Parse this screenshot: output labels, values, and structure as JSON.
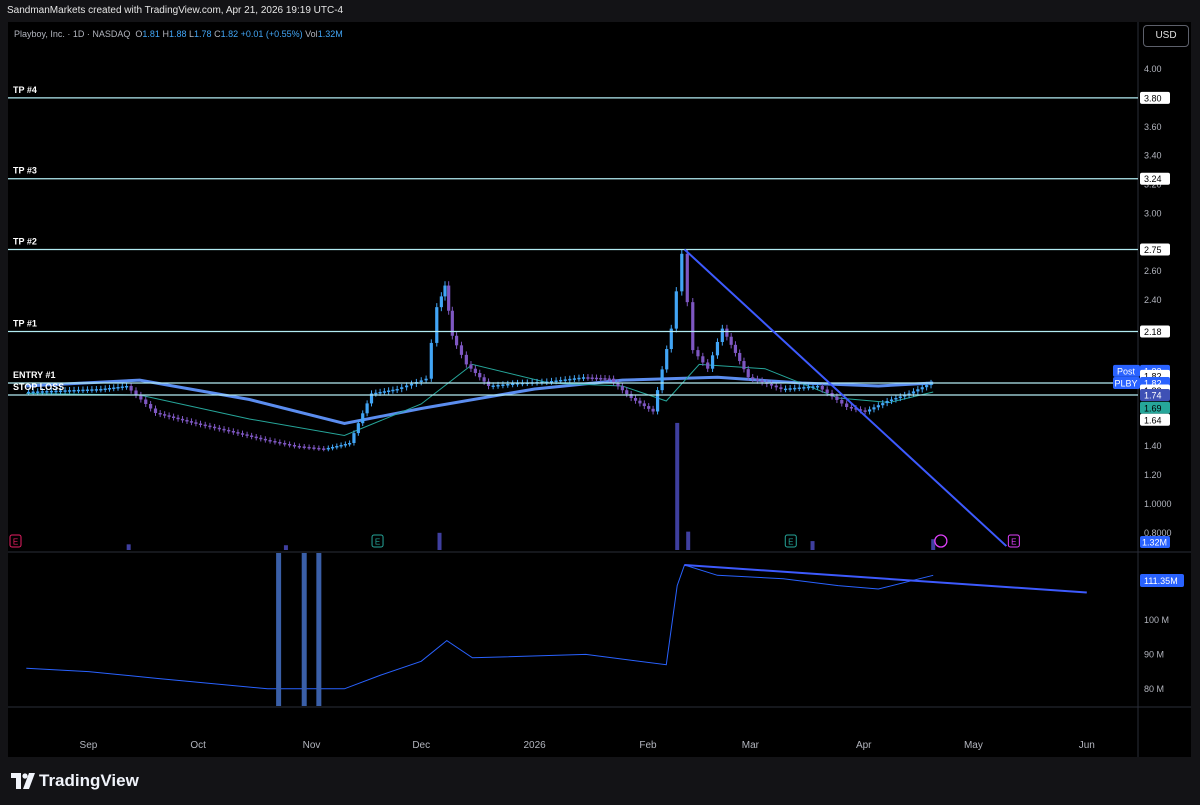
{
  "header": {
    "attribution": "SandmanMarkets created with TradingView.com, Apr 21, 2026 19:19 UTC-4"
  },
  "legend": {
    "symbol": "Playboy, Inc. · 1D · NASDAQ",
    "open_label": "O",
    "open": "1.81",
    "high_label": "H",
    "high": "1.88",
    "low_label": "L",
    "low": "1.78",
    "close_label": "C",
    "close": "1.82",
    "change": "+0.01 (+0.55%)",
    "volume_label": "Vol",
    "volume": "1.32M"
  },
  "currency_button": "USD",
  "brand": {
    "name": "TradingView"
  },
  "colors": {
    "up": "#42a5f5",
    "down": "#7e57c2",
    "ma_slow": "#5b8def",
    "ma_fast": "#2196f3",
    "ma_teal": "#26a69a",
    "level": "#b2ebf2",
    "trendline": "#3d5afe",
    "volume": "#3f3f9f"
  },
  "chart_data": {
    "type": "candlestick",
    "title": "Playboy, Inc. · 1D · NASDAQ",
    "y_ticks": [
      "4.00",
      "3.60",
      "3.40",
      "3.20",
      "3.00",
      "2.60",
      "2.40",
      "1.40",
      "1.20",
      "1.0000",
      "0.8000"
    ],
    "x_ticks": [
      {
        "label": "Sep",
        "date": "2025-09-01"
      },
      {
        "label": "Oct",
        "date": "2025-10-01"
      },
      {
        "label": "Nov",
        "date": "2025-11-01"
      },
      {
        "label": "Dec",
        "date": "2025-12-01"
      },
      {
        "label": "2026",
        "date": "2026-01-01"
      },
      {
        "label": "Feb",
        "date": "2026-02-01"
      },
      {
        "label": "Mar",
        "date": "2026-03-01"
      },
      {
        "label": "Apr",
        "date": "2026-04-01"
      },
      {
        "label": "May",
        "date": "2026-05-01"
      },
      {
        "label": "Jun",
        "date": "2026-06-01"
      }
    ],
    "levels": [
      {
        "name": "TP #4",
        "value": 3.8
      },
      {
        "name": "TP #3",
        "value": 3.24
      },
      {
        "name": "TP #2",
        "value": 2.75
      },
      {
        "name": "TP #1",
        "value": 2.18
      },
      {
        "name": "ENTRY #1",
        "value": 1.82
      },
      {
        "name": "STOP LOSS",
        "value": 1.74
      }
    ],
    "price_tags": [
      {
        "label": "",
        "value": "3.80",
        "price": 3.8,
        "bg": "#ffffff",
        "fg": "#000000"
      },
      {
        "label": "",
        "value": "3.24",
        "price": 3.24,
        "bg": "#ffffff",
        "fg": "#000000"
      },
      {
        "label": "",
        "value": "2.75",
        "price": 2.75,
        "bg": "#ffffff",
        "fg": "#000000"
      },
      {
        "label": "",
        "value": "2.18",
        "price": 2.18,
        "bg": "#ffffff",
        "fg": "#000000"
      },
      {
        "label": "Post",
        "value": "1.82",
        "price": 1.905,
        "bg": "#2962ff",
        "fg": "#ffffff"
      },
      {
        "label": "",
        "value": "1.82",
        "price": 1.87,
        "bg": "#ffffff",
        "fg": "#000000"
      },
      {
        "label": "PLBY",
        "value": "1.82",
        "price": 1.82,
        "bg": "#2962ff",
        "fg": "#ffffff"
      },
      {
        "label": "",
        "value": "1.82",
        "price": 1.77,
        "bg": "#ffffff",
        "fg": "#000000"
      },
      {
        "label": "",
        "value": "1.74",
        "price": 1.74,
        "bg": "#3f51b5",
        "fg": "#ffffff"
      },
      {
        "label": "",
        "value": "1.69",
        "price": 1.655,
        "bg": "#26a69a",
        "fg": "#000000"
      },
      {
        "label": "",
        "value": "1.64",
        "price": 1.575,
        "bg": "#ffffff",
        "fg": "#000000"
      }
    ],
    "volume_tag": "1.32M",
    "close_series": [
      {
        "date": "2025-08-15",
        "close": 1.76
      },
      {
        "date": "2025-08-25",
        "close": 1.77
      },
      {
        "date": "2025-09-05",
        "close": 1.78
      },
      {
        "date": "2025-09-12",
        "close": 1.8
      },
      {
        "date": "2025-09-20",
        "close": 1.62
      },
      {
        "date": "2025-10-01",
        "close": 1.55
      },
      {
        "date": "2025-10-10",
        "close": 1.5
      },
      {
        "date": "2025-10-20",
        "close": 1.44
      },
      {
        "date": "2025-10-28",
        "close": 1.4
      },
      {
        "date": "2025-11-05",
        "close": 1.38
      },
      {
        "date": "2025-11-12",
        "close": 1.42
      },
      {
        "date": "2025-11-18",
        "close": 1.75
      },
      {
        "date": "2025-11-25",
        "close": 1.78
      },
      {
        "date": "2025-12-03",
        "close": 1.85
      },
      {
        "date": "2025-12-06",
        "close": 2.35
      },
      {
        "date": "2025-12-08",
        "close": 2.5
      },
      {
        "date": "2025-12-10",
        "close": 2.15
      },
      {
        "date": "2025-12-14",
        "close": 1.95
      },
      {
        "date": "2025-12-20",
        "close": 1.8
      },
      {
        "date": "2025-12-28",
        "close": 1.82
      },
      {
        "date": "2026-01-05",
        "close": 1.83
      },
      {
        "date": "2026-01-15",
        "close": 1.86
      },
      {
        "date": "2026-01-22",
        "close": 1.85
      },
      {
        "date": "2026-01-28",
        "close": 1.72
      },
      {
        "date": "2026-02-03",
        "close": 1.63
      },
      {
        "date": "2026-02-08",
        "close": 2.2
      },
      {
        "date": "2026-02-11",
        "close": 2.72
      },
      {
        "date": "2026-02-14",
        "close": 2.05
      },
      {
        "date": "2026-02-18",
        "close": 1.92
      },
      {
        "date": "2026-02-22",
        "close": 2.2
      },
      {
        "date": "2026-03-01",
        "close": 1.86
      },
      {
        "date": "2026-03-10",
        "close": 1.78
      },
      {
        "date": "2026-03-20",
        "close": 1.8
      },
      {
        "date": "2026-03-28",
        "close": 1.66
      },
      {
        "date": "2026-04-02",
        "close": 1.63
      },
      {
        "date": "2026-04-08",
        "close": 1.7
      },
      {
        "date": "2026-04-14",
        "close": 1.75
      },
      {
        "date": "2026-04-20",
        "close": 1.82
      }
    ],
    "trendline": [
      {
        "date": "2026-02-11",
        "price": 2.75
      },
      {
        "date": "2026-05-10",
        "price": 0.71
      }
    ],
    "volume_series": [
      {
        "date": "2025-09-12",
        "volume_m": 0.45
      },
      {
        "date": "2025-10-25",
        "volume_m": 0.3
      },
      {
        "date": "2025-12-06",
        "volume_m": 2.4
      },
      {
        "date": "2026-02-09",
        "volume_m": 21.0
      },
      {
        "date": "2026-02-12",
        "volume_m": 2.6
      },
      {
        "date": "2026-03-18",
        "volume_m": 1.0
      },
      {
        "date": "2026-04-20",
        "volume_m": 1.32
      }
    ],
    "obv_panel": {
      "ticks": [
        "100 M",
        "90 M",
        "80 M"
      ],
      "tag": "111.35M",
      "values_m": [
        {
          "date": "2025-08-15",
          "v": 86
        },
        {
          "date": "2025-09-01",
          "v": 85
        },
        {
          "date": "2025-09-20",
          "v": 83
        },
        {
          "date": "2025-10-20",
          "v": 80
        },
        {
          "date": "2025-11-10",
          "v": 80
        },
        {
          "date": "2025-11-20",
          "v": 84
        },
        {
          "date": "2025-12-01",
          "v": 88
        },
        {
          "date": "2025-12-08",
          "v": 94
        },
        {
          "date": "2025-12-15",
          "v": 89
        },
        {
          "date": "2026-01-15",
          "v": 90
        },
        {
          "date": "2026-02-06",
          "v": 87
        },
        {
          "date": "2026-02-09",
          "v": 110
        },
        {
          "date": "2026-02-11",
          "v": 116
        },
        {
          "date": "2026-02-20",
          "v": 113
        },
        {
          "date": "2026-03-10",
          "v": 112
        },
        {
          "date": "2026-03-25",
          "v": 110
        },
        {
          "date": "2026-04-05",
          "v": 109
        },
        {
          "date": "2026-04-20",
          "v": 113
        }
      ],
      "trendline": [
        {
          "date": "2026-02-11",
          "v": 116
        },
        {
          "date": "2026-06-01",
          "v": 108
        }
      ]
    }
  }
}
